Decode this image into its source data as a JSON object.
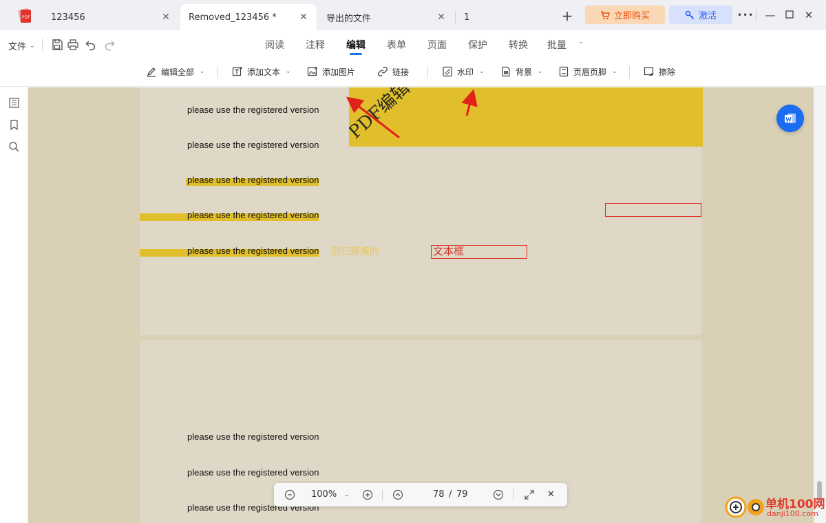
{
  "tabs": [
    {
      "label": "123456",
      "active": false
    },
    {
      "label": "Removed_123456 *",
      "active": true
    },
    {
      "label": "导出的文件",
      "active": false
    },
    {
      "label": "1",
      "active": false
    }
  ],
  "header_buttons": {
    "buy": "立即购买",
    "activate": "激活"
  },
  "menubar": {
    "file": "文件",
    "tabs": [
      "阅读",
      "注释",
      "编辑",
      "表单",
      "页面",
      "保护",
      "转换",
      "批量"
    ],
    "active_tab": "编辑"
  },
  "toolbar": {
    "edit_all": "编辑全部",
    "add_text": "添加文本",
    "add_image": "添加图片",
    "link": "链接",
    "watermark": "水印",
    "background": "背景",
    "header_footer": "页眉页脚",
    "erase": "擦除"
  },
  "document": {
    "line_text": "please use the registered version",
    "image_overlay_text": "PDF编辑",
    "faint_text": "回归辉煌的",
    "textbox_label": "文本框"
  },
  "zoom": {
    "level": "100%",
    "current_page": "78",
    "separator": "/",
    "total_pages": "79"
  },
  "site": {
    "name": "单机100网",
    "url": "danji100.com"
  },
  "colors": {
    "accent": "#1a73e8",
    "highlight": "#e1bf2c",
    "arrow": "#e0221b",
    "page": "#e0d8c7",
    "canvas": "#d9d0b6"
  }
}
